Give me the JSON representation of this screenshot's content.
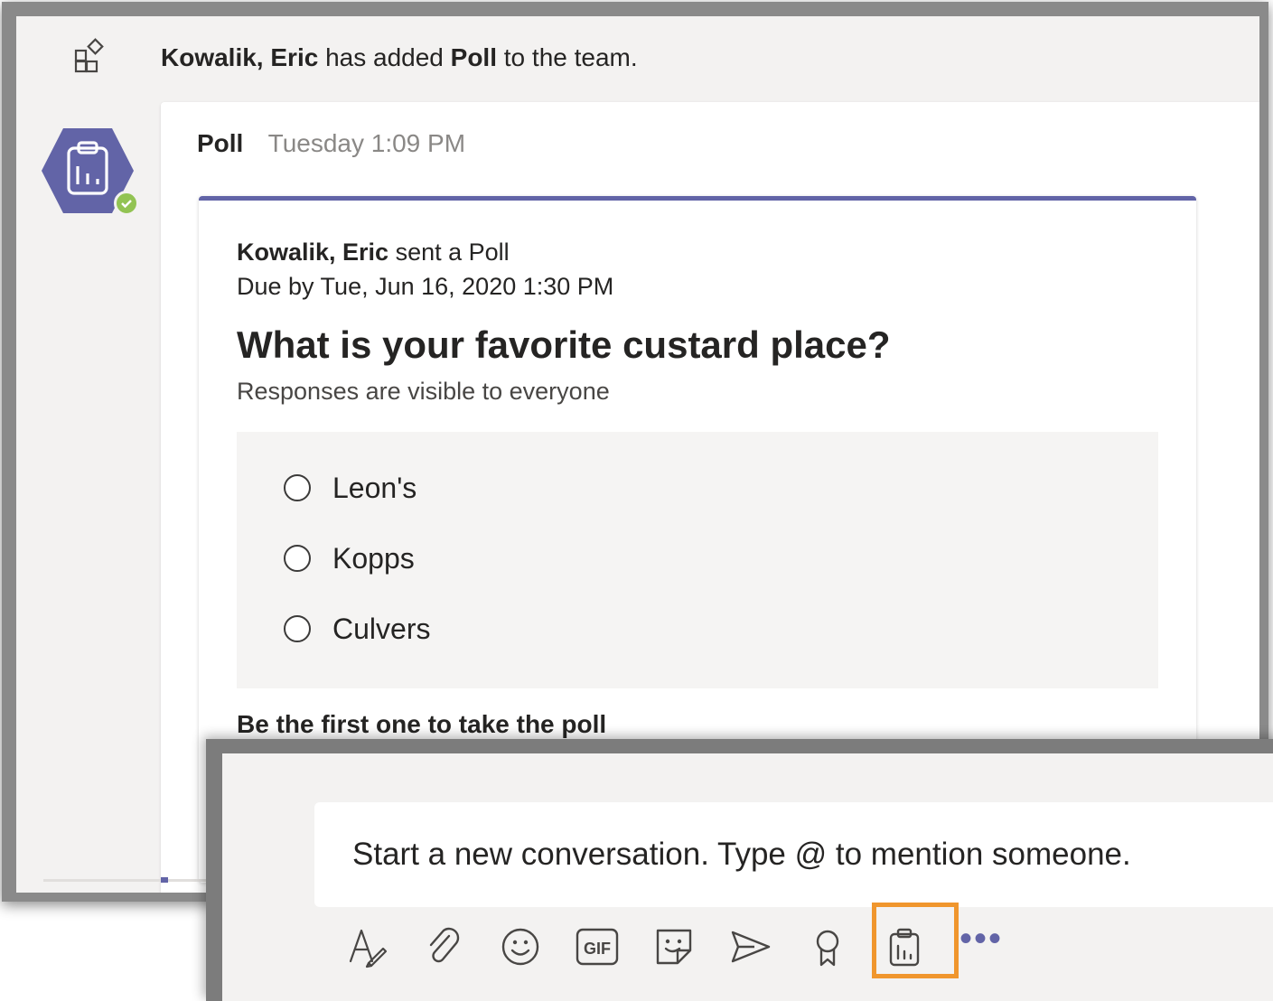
{
  "system_message": {
    "actor": "Kowalik, Eric",
    "action": "has added",
    "app": "Poll",
    "suffix": "to the team."
  },
  "message": {
    "sender": "Poll",
    "timestamp": "Tuesday 1:09 PM"
  },
  "poll": {
    "author": "Kowalik, Eric",
    "sent_text": "sent a Poll",
    "due": "Due by Tue, Jun 16, 2020 1:30 PM",
    "question": "What is your favorite custard place?",
    "visibility": "Responses are visible to everyone",
    "options": [
      {
        "label": "Leon's",
        "selected": false
      },
      {
        "label": "Kopps",
        "selected": false
      },
      {
        "label": "Culvers",
        "selected": false
      }
    ],
    "cta": "Be the first one to take the poll"
  },
  "compose": {
    "placeholder": "Start a new conversation. Type @ to mention someone."
  },
  "toolbar": {
    "gif_label": "GIF",
    "items": [
      "format-icon",
      "attach-icon",
      "emoji-icon",
      "gif-icon",
      "sticker-icon",
      "meet-icon",
      "praise-icon",
      "poll-icon",
      "more-icon"
    ],
    "highlighted": "poll-icon"
  },
  "colors": {
    "accent": "#6264a7",
    "presence": "#92c353",
    "highlight": "#f0962d"
  }
}
